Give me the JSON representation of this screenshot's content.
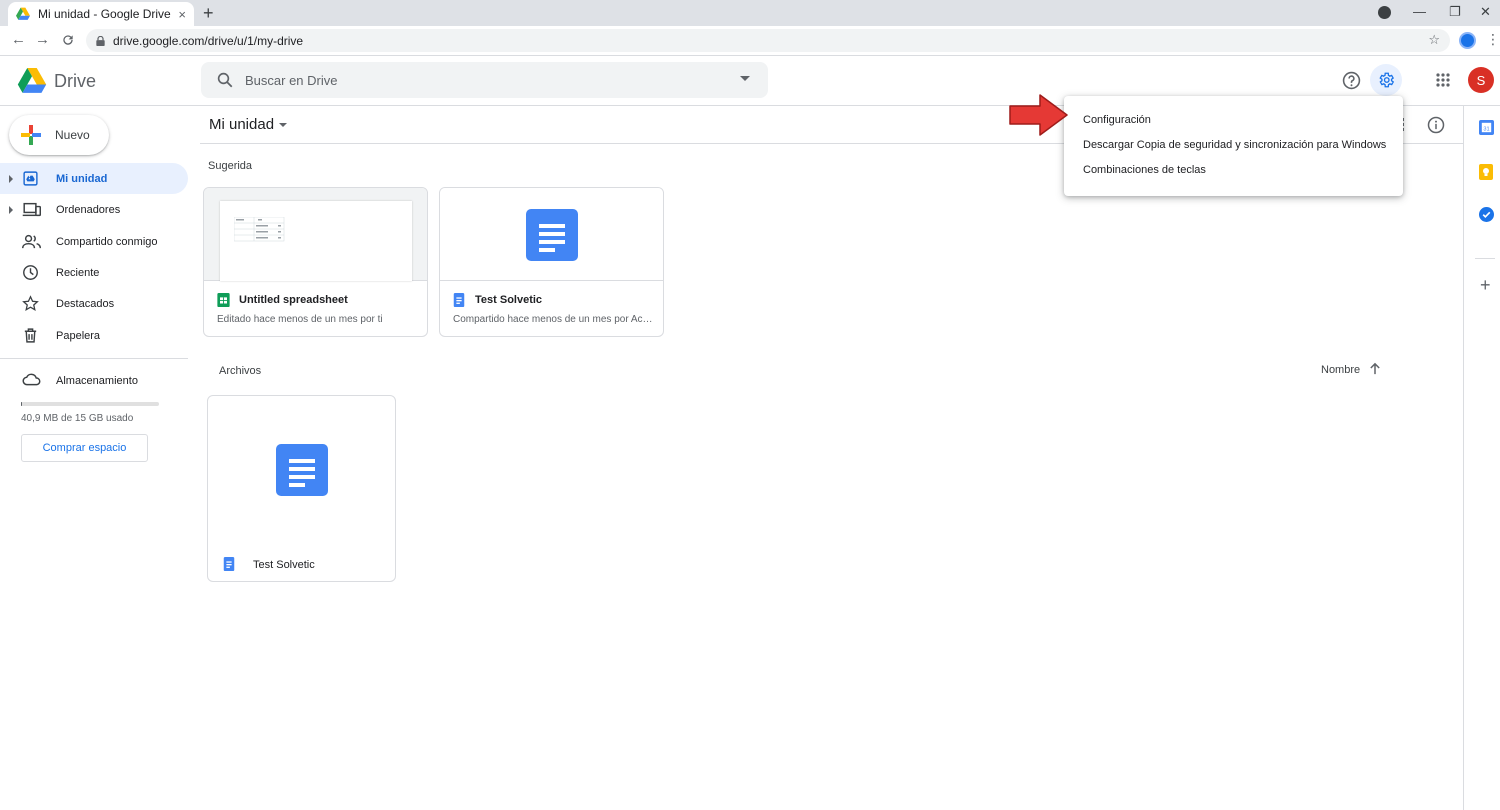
{
  "browser": {
    "tab_title": "Mi unidad - Google Drive",
    "tab_close": "×",
    "new_tab": "+",
    "url": "drive.google.com/drive/u/1/my-drive",
    "win_minimize": "—",
    "win_restore": "❐",
    "win_close": "✕"
  },
  "header": {
    "brand": "Drive",
    "search_placeholder": "Buscar en Drive",
    "user_initial": "S"
  },
  "sidebar": {
    "new_label": "Nuevo",
    "items": [
      {
        "label": "Mi unidad",
        "icon": "my-drive-icon"
      },
      {
        "label": "Ordenadores",
        "icon": "computers-icon"
      },
      {
        "label": "Compartido conmigo",
        "icon": "shared-icon"
      },
      {
        "label": "Reciente",
        "icon": "clock-icon"
      },
      {
        "label": "Destacados",
        "icon": "star-icon"
      },
      {
        "label": "Papelera",
        "icon": "trash-icon"
      }
    ],
    "storage_label": "Almacenamiento",
    "storage_used_text": "40,9 MB de 15 GB usado",
    "storage_fraction": 0.003,
    "buy_label": "Comprar espacio"
  },
  "main": {
    "title": "Mi unidad",
    "suggested_label": "Sugerida",
    "files_label": "Archivos",
    "sort_label": "Nombre",
    "suggested": [
      {
        "name": "Untitled spreadsheet",
        "sub": "Editado hace menos de un mes por ti",
        "type": "sheet"
      },
      {
        "name": "Test Solvetic",
        "sub": "Compartido hace menos de un mes por Acce...",
        "type": "doc"
      }
    ],
    "files": [
      {
        "name": "Test Solvetic",
        "type": "doc"
      }
    ]
  },
  "menu": {
    "items": [
      "Configuración",
      "Descargar Copia de seguridad y sincronización para Windows",
      "Combinaciones de teclas"
    ]
  },
  "colors": {
    "accent": "#1a73e8",
    "active_bg": "#e8f0fe",
    "doc_blue": "#4285f4",
    "sheet_green": "#0f9d58",
    "annotation_red": "#e53935"
  }
}
